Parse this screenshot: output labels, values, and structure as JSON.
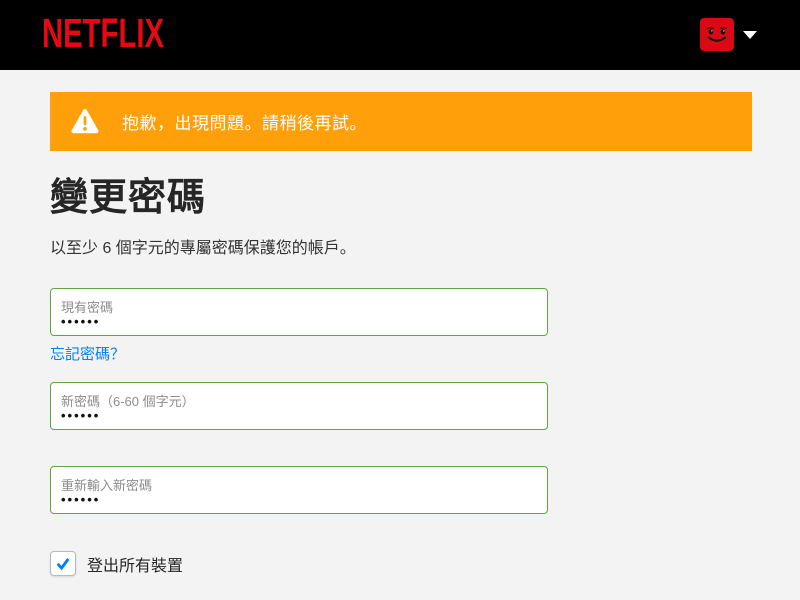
{
  "header": {
    "logo_text": "NETFLIX"
  },
  "icons": {
    "warning": "triangle-exclamation",
    "profile_caret": "chevron-down",
    "checkbox_check": "check",
    "profile_avatar": "red-smiley-face"
  },
  "alert": {
    "message": "抱歉，出現問題。請稍後再試。"
  },
  "page": {
    "title": "變更密碼",
    "subtitle": "以至少 6 個字元的專屬密碼保護您的帳戶。"
  },
  "form": {
    "current_password": {
      "label": "現有密碼",
      "value": "••••••"
    },
    "forgot_password_link": "忘記密碼？",
    "new_password": {
      "label": "新密碼（6-60 個字元）",
      "value": "••••••"
    },
    "confirm_password": {
      "label": "重新輸入新密碼",
      "value": "••••••"
    },
    "signout_all_devices": {
      "label": "登出所有裝置",
      "checked": true
    }
  },
  "colors": {
    "brand_red": "#e50914",
    "alert_orange": "#ffa00a",
    "input_valid_green": "#5fa53f",
    "link_blue": "#0080ff",
    "header_black": "#000000",
    "page_background": "#f3f3f3"
  }
}
